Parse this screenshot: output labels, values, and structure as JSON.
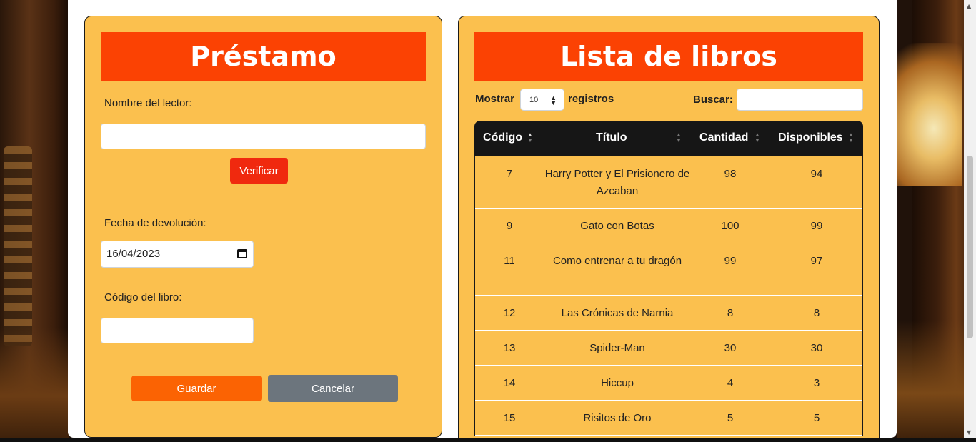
{
  "loan_form": {
    "title": "Préstamo",
    "reader_label": "Nombre del lector:",
    "reader_value": "",
    "verify_button": "Verificar",
    "return_date_label": "Fecha de devolución:",
    "return_date_value": "16/04/2023",
    "book_code_label": "Código del libro:",
    "book_code_value": "",
    "save_button": "Guardar",
    "cancel_button": "Cancelar"
  },
  "book_list": {
    "title": "Lista de libros",
    "show_label": "Mostrar",
    "page_size": "10",
    "records_label": "registros",
    "search_label": "Buscar:",
    "search_value": "",
    "columns": [
      "Código",
      "Título",
      "Cantidad",
      "Disponibles"
    ],
    "rows": [
      {
        "code": "7",
        "title": "Harry Potter y El Prisionero de Azcaban",
        "qty": "98",
        "available": "94"
      },
      {
        "code": "9",
        "title": "Gato con Botas",
        "qty": "100",
        "available": "99"
      },
      {
        "code": "11",
        "title": "Como entrenar a tu dragón",
        "qty": "99",
        "available": "97"
      },
      {
        "code": "12",
        "title": "Las Crónicas de Narnia",
        "qty": "8",
        "available": "8"
      },
      {
        "code": "13",
        "title": "Spider-Man",
        "qty": "30",
        "available": "30"
      },
      {
        "code": "14",
        "title": "Hiccup",
        "qty": "4",
        "available": "3"
      },
      {
        "code": "15",
        "title": "Risitos de Oro",
        "qty": "5",
        "available": "5"
      }
    ]
  },
  "colors": {
    "banner": "#fb4203",
    "card": "#fbc04e",
    "verify": "#f0290e",
    "save": "#fb6303",
    "cancel": "#6c757d",
    "table_header": "#161616"
  }
}
